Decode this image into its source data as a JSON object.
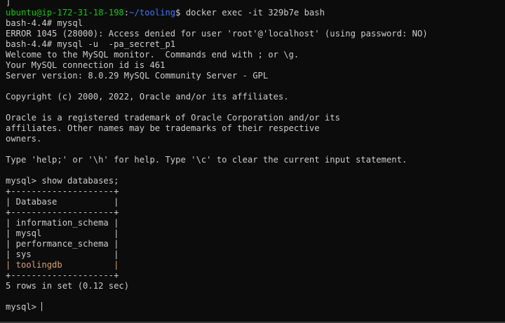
{
  "colors": {
    "background": "#0c0c0c",
    "text": "#cccccc",
    "prompt_user": "#16c60c",
    "prompt_path": "#3b78ff",
    "highlight_row": "#d8a070"
  },
  "lines": {
    "l00": "]",
    "prompt_user": "ubuntu@ip-172-31-18-198",
    "prompt_colon": ":",
    "prompt_path": "~/tooling",
    "prompt_cmd": "$ docker exec -it 329b7e bash",
    "l02": "bash-4.4# mysql",
    "l03": "ERROR 1045 (28000): Access denied for user 'root'@'localhost' (using password: NO)",
    "l04": "bash-4.4# mysql -u  -pa_secret_p1",
    "l05": "Welcome to the MySQL monitor.  Commands end with ; or \\g.",
    "l06": "Your MySQL connection id is 461",
    "l07": "Server version: 8.0.29 MySQL Community Server - GPL",
    "l09": "Copyright (c) 2000, 2022, Oracle and/or its affiliates.",
    "l11": "Oracle is a registered trademark of Oracle Corporation and/or its",
    "l12": "affiliates. Other names may be trademarks of their respective",
    "l13": "owners.",
    "l15": "Type 'help;' or '\\h' for help. Type '\\c' to clear the current input statement.",
    "l17": "mysql> show databases;",
    "l18": "+--------------------+",
    "l19": "| Database           |",
    "l20": "+--------------------+",
    "l21": "| information_schema |",
    "l22": "| mysql              |",
    "l23": "| performance_schema |",
    "l24": "| sys                |",
    "l25": "| toolingdb          |",
    "l26": "+--------------------+",
    "l27": "5 rows in set (0.12 sec)",
    "l29": "mysql> "
  }
}
